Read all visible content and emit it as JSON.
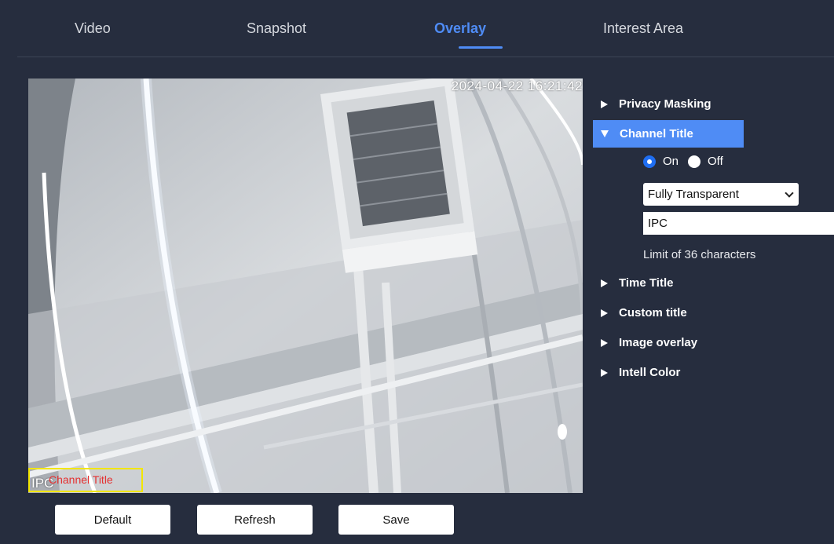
{
  "tabs": [
    {
      "label": "Video"
    },
    {
      "label": "Snapshot"
    },
    {
      "label": "Overlay",
      "active": true
    },
    {
      "label": "Interest Area"
    }
  ],
  "preview": {
    "timestamp": "2024-04-22 16:21:42",
    "channel_osd_label": "Channel Title",
    "channel_osd_text": "IPC"
  },
  "panel": {
    "sections": {
      "privacy_masking": "Privacy Masking",
      "channel_title": "Channel Title",
      "time_title": "Time Title",
      "custom_title": "Custom title",
      "image_overlay": "Image overlay",
      "intell_color": "Intell Color"
    },
    "channel_title": {
      "on_label": "On",
      "off_label": "Off",
      "selected": "On",
      "transparency": "Fully Transparent",
      "title_value": "IPC",
      "hint": "Limit of 36 characters"
    }
  },
  "buttons": {
    "default": "Default",
    "refresh": "Refresh",
    "save": "Save"
  },
  "colors": {
    "background": "#262d3e",
    "accent": "#4f8cf5",
    "osd_box": "#f2e600",
    "osd_label": "#e53030"
  }
}
